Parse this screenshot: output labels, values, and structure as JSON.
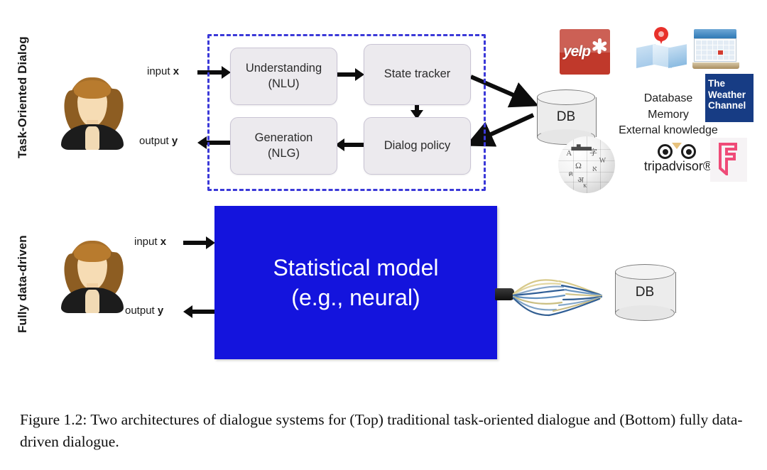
{
  "figure": {
    "caption": "Figure 1.2: Two architectures of dialogue systems for (Top) traditional task-oriented dialogue and (Bottom) fully data-driven dialogue."
  },
  "top_panel": {
    "side_label": "Task-Oriented Dialog",
    "input_label_prefix": "input ",
    "input_label_var": "x",
    "output_label_prefix": "output ",
    "output_label_var": "y",
    "boxes": [
      {
        "id": "nlu",
        "line1": "Understanding",
        "line2": "(NLU)"
      },
      {
        "id": "state_tracker",
        "line1": "State tracker",
        "line2": ""
      },
      {
        "id": "nlg",
        "line1": "Generation",
        "line2": "(NLG)"
      },
      {
        "id": "dialog_policy",
        "line1": "Dialog policy",
        "line2": ""
      }
    ],
    "database": {
      "label": "DB"
    },
    "knowledge_lines": [
      "Database",
      "Memory",
      "External knowledge"
    ],
    "logos": [
      {
        "id": "yelp",
        "label": "yelp"
      },
      {
        "id": "map",
        "label": "map-icon"
      },
      {
        "id": "calendar",
        "label": "calendar-icon"
      },
      {
        "id": "weather",
        "line1": "The",
        "line2": "Weather",
        "line3": "Channel"
      },
      {
        "id": "wikipedia",
        "label": "wikipedia-globe"
      },
      {
        "id": "tripadvisor",
        "label": "tripadvisor®"
      },
      {
        "id": "foursquare",
        "label": "foursquare"
      }
    ]
  },
  "bottom_panel": {
    "side_label": "Fully data-driven",
    "input_label_prefix": "input ",
    "input_label_var": "x",
    "output_label_prefix": "output ",
    "output_label_var": "y",
    "model_box": {
      "line1": "Statistical model",
      "line2": "(e.g., neural)"
    },
    "database": {
      "label": "DB"
    },
    "cable": {
      "label": "cable-bundle"
    }
  },
  "colors": {
    "dashed_border": "#3b39d8",
    "model_box_bg": "#1414dd",
    "pipeline_box_bg": "#eceaee",
    "yelp_red": "#c0392b",
    "weather_blue": "#173c84",
    "foursquare_pink": "#ef4b78"
  }
}
